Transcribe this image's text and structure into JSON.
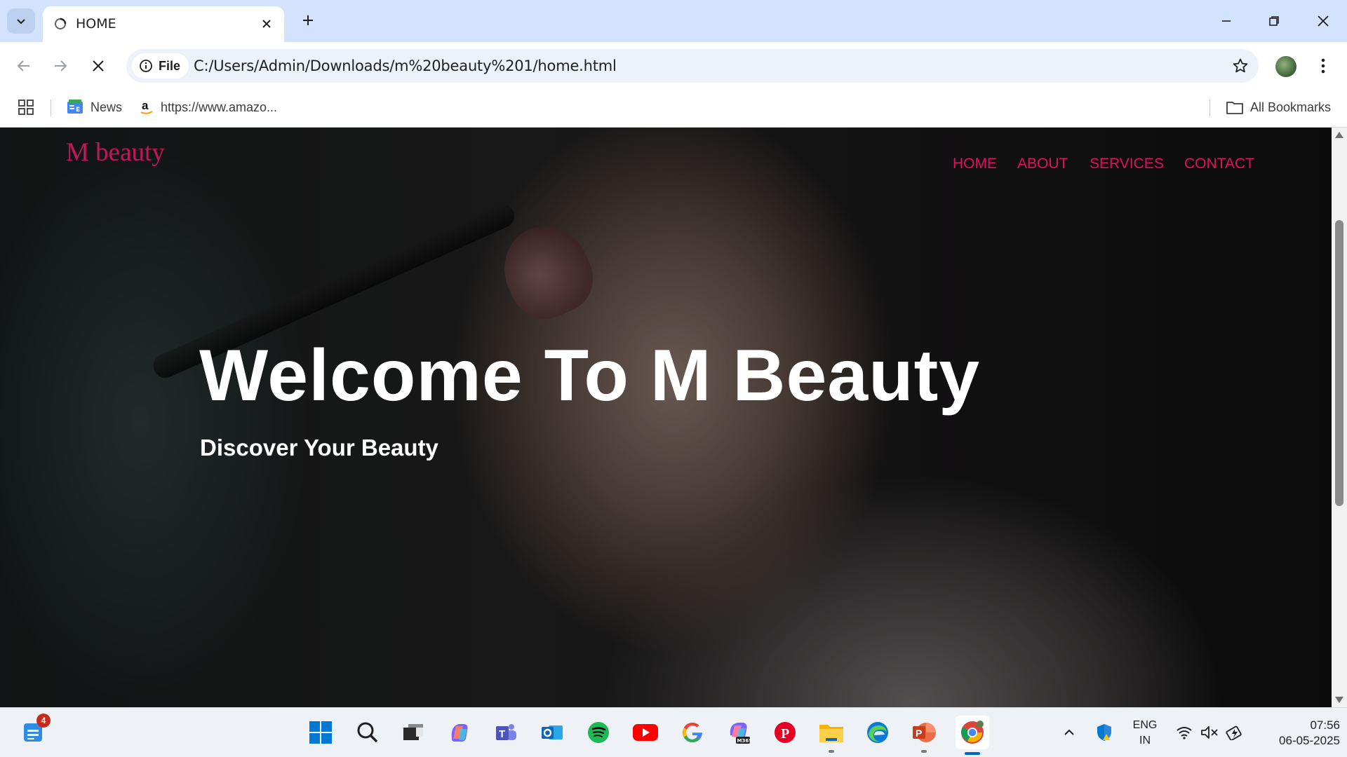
{
  "browser": {
    "tab_title": "HOME",
    "omnibox": {
      "scheme_chip": "File",
      "url": "C:/Users/Admin/Downloads/m%20beauty%201/home.html"
    },
    "bookmarks": {
      "items": [
        {
          "label": "News",
          "icon": "google-news-icon"
        },
        {
          "label": "https://www.amazo...",
          "icon": "amazon-icon"
        }
      ],
      "all_bookmarks": "All Bookmarks"
    }
  },
  "site": {
    "logo": "M beauty",
    "nav": [
      "HOME",
      "ABOUT",
      "SERVICES",
      "CONTACT"
    ],
    "hero": {
      "title": "Welcome To M Beauty",
      "subtitle": "Discover Your Beauty"
    },
    "colors": {
      "accent": "#e0115f",
      "logo": "#c2185b",
      "hero_text": "#ffffff"
    }
  },
  "taskbar": {
    "widgets_badge": "4",
    "apps": [
      "start-icon",
      "search-icon",
      "task-view-icon",
      "copilot-icon",
      "teams-icon",
      "outlook-icon",
      "spotify-icon",
      "youtube-icon",
      "google-icon",
      "m365-icon",
      "pinterest-icon",
      "file-explorer-icon",
      "edge-icon",
      "powerpoint-icon",
      "chrome-icon"
    ],
    "tray": {
      "language_line1": "ENG",
      "language_line2": "IN",
      "time": "07:56",
      "date": "06-05-2025"
    }
  }
}
